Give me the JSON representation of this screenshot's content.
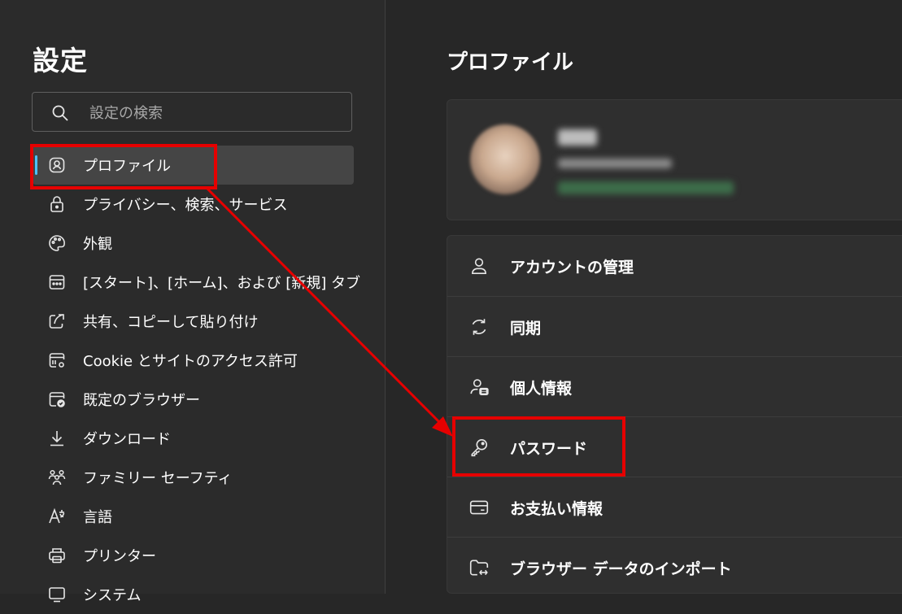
{
  "sidebar": {
    "title": "設定",
    "search_placeholder": "設定の検索",
    "items": [
      {
        "label": "プロファイル",
        "icon": "profile-icon",
        "active": true
      },
      {
        "label": "プライバシー、検索、サービス",
        "icon": "lock-icon"
      },
      {
        "label": "外観",
        "icon": "palette-icon"
      },
      {
        "label": "[スタート]、[ホーム]、および [新規] タブ",
        "icon": "home-tabs-icon"
      },
      {
        "label": "共有、コピーして貼り付け",
        "icon": "share-icon"
      },
      {
        "label": "Cookie とサイトのアクセス許可",
        "icon": "site-permissions-icon"
      },
      {
        "label": "既定のブラウザー",
        "icon": "default-browser-icon"
      },
      {
        "label": "ダウンロード",
        "icon": "download-icon"
      },
      {
        "label": "ファミリー セーフティ",
        "icon": "family-icon"
      },
      {
        "label": "言語",
        "icon": "language-icon"
      },
      {
        "label": "プリンター",
        "icon": "printer-icon"
      },
      {
        "label": "システム",
        "icon": "system-icon"
      }
    ]
  },
  "main": {
    "title": "プロファイル",
    "rows": [
      {
        "label": "アカウントの管理",
        "icon": "person-icon"
      },
      {
        "label": "同期",
        "icon": "sync-icon"
      },
      {
        "label": "個人情報",
        "icon": "personal-info-icon"
      },
      {
        "label": "パスワード",
        "icon": "key-icon"
      },
      {
        "label": "お支払い情報",
        "icon": "card-icon"
      },
      {
        "label": "ブラウザー データのインポート",
        "icon": "import-icon"
      }
    ]
  },
  "colors": {
    "accent": "#4cc2ff",
    "annotation": "#e60000",
    "background": "#272727",
    "sidebar": "#2b2b2b",
    "card": "#2f2f2f"
  }
}
